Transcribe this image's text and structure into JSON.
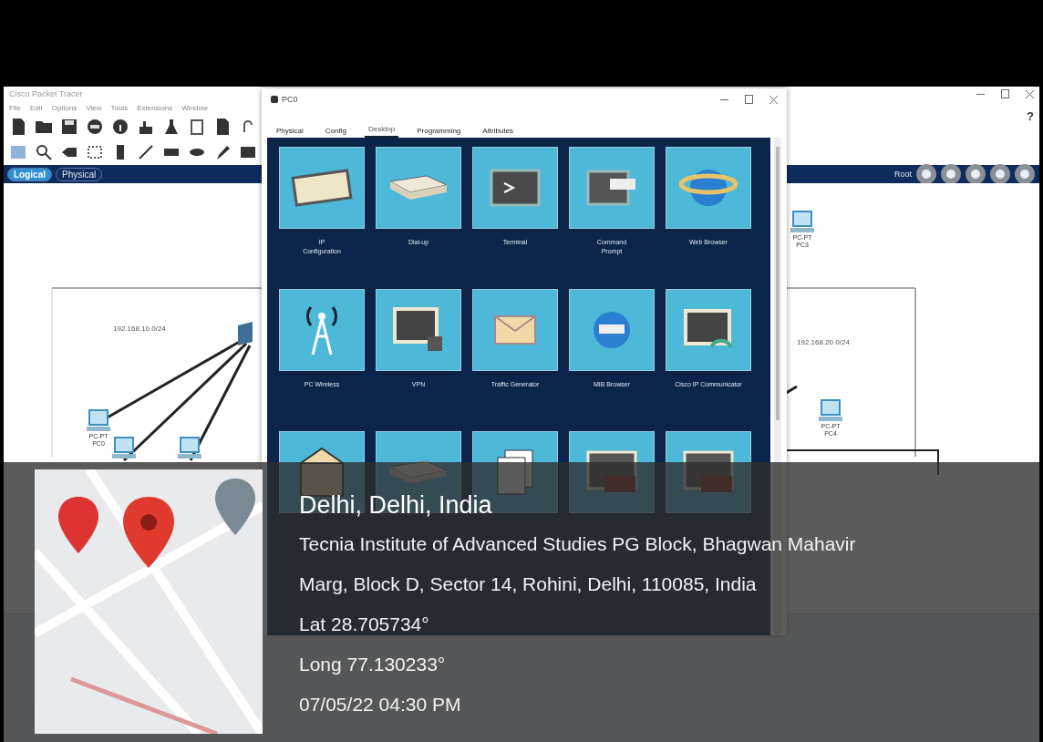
{
  "main_window": {
    "title": "Cisco Packet Tracer",
    "menu": [
      "File",
      "Edit",
      "Options",
      "View",
      "Tools",
      "Extensions",
      "Window"
    ],
    "help": "?",
    "modes": [
      {
        "label": "Logical",
        "selected": true
      },
      {
        "label": "Physical",
        "selected": false
      }
    ],
    "root": "Root"
  },
  "workspace": {
    "areas": [
      {
        "label": "192.168.10.0/24"
      },
      {
        "label": "192.168.20.0/24"
      }
    ],
    "devices": [
      {
        "kind": "switch"
      },
      {
        "kind": "pc",
        "label": "PC-PT\nPC0"
      },
      {
        "kind": "pc"
      },
      {
        "kind": "pc"
      },
      {
        "kind": "pc",
        "label": "PC-PT\nPC3"
      },
      {
        "kind": "pc",
        "label": "PC-PT\nPC4"
      }
    ]
  },
  "dialog": {
    "title": "PC0",
    "tabs": [
      {
        "label": "Physical",
        "selected": false
      },
      {
        "label": "Config",
        "selected": false
      },
      {
        "label": "Desktop",
        "selected": true
      },
      {
        "label": "Programming",
        "selected": false
      },
      {
        "label": "Attributes",
        "selected": false
      }
    ],
    "apps": [
      {
        "kind": "ip",
        "label": "IP\nConfiguration"
      },
      {
        "kind": "dialup",
        "label": "Dial-up"
      },
      {
        "kind": "terminal",
        "label": "Terminal"
      },
      {
        "kind": "cmd",
        "label": "Command\nPrompt"
      },
      {
        "kind": "web",
        "label": "Web Browser"
      },
      {
        "kind": "wireless",
        "label": "PC Wireless"
      },
      {
        "kind": "vpn",
        "label": "VPN"
      },
      {
        "kind": "traffic",
        "label": "Traffic Generator"
      },
      {
        "kind": "mib",
        "label": "MIB Browser"
      },
      {
        "kind": "ipcomm",
        "label": "Cisco IP Communicator"
      },
      {
        "kind": "email"
      },
      {
        "kind": "pppoe"
      },
      {
        "kind": "editor"
      },
      {
        "kind": "firewall"
      },
      {
        "kind": "firewall"
      }
    ]
  },
  "stamp": {
    "place": "Delhi, Delhi, India",
    "address": "Tecnia Institute of Advanced Studies PG Block, Bhagwan Mahavir Marg, Block D, Sector 14, Rohini, Delhi, 110085, India",
    "latitude": "Lat 28.705734°",
    "longitude": "Long 77.130233°",
    "datetime": "07/05/22 04:30 PM"
  }
}
